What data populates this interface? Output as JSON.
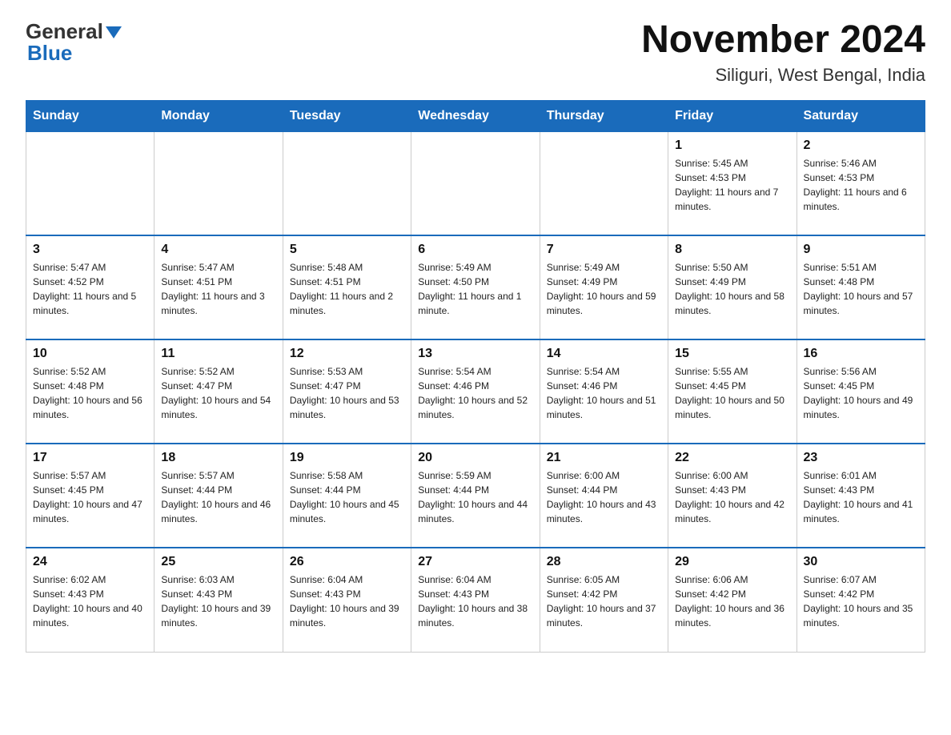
{
  "header": {
    "logo_general": "General",
    "logo_blue": "Blue",
    "month_title": "November 2024",
    "subtitle": "Siliguri, West Bengal, India"
  },
  "days_of_week": [
    "Sunday",
    "Monday",
    "Tuesday",
    "Wednesday",
    "Thursday",
    "Friday",
    "Saturday"
  ],
  "weeks": [
    [
      {
        "num": "",
        "info": ""
      },
      {
        "num": "",
        "info": ""
      },
      {
        "num": "",
        "info": ""
      },
      {
        "num": "",
        "info": ""
      },
      {
        "num": "",
        "info": ""
      },
      {
        "num": "1",
        "info": "Sunrise: 5:45 AM\nSunset: 4:53 PM\nDaylight: 11 hours and 7 minutes."
      },
      {
        "num": "2",
        "info": "Sunrise: 5:46 AM\nSunset: 4:53 PM\nDaylight: 11 hours and 6 minutes."
      }
    ],
    [
      {
        "num": "3",
        "info": "Sunrise: 5:47 AM\nSunset: 4:52 PM\nDaylight: 11 hours and 5 minutes."
      },
      {
        "num": "4",
        "info": "Sunrise: 5:47 AM\nSunset: 4:51 PM\nDaylight: 11 hours and 3 minutes."
      },
      {
        "num": "5",
        "info": "Sunrise: 5:48 AM\nSunset: 4:51 PM\nDaylight: 11 hours and 2 minutes."
      },
      {
        "num": "6",
        "info": "Sunrise: 5:49 AM\nSunset: 4:50 PM\nDaylight: 11 hours and 1 minute."
      },
      {
        "num": "7",
        "info": "Sunrise: 5:49 AM\nSunset: 4:49 PM\nDaylight: 10 hours and 59 minutes."
      },
      {
        "num": "8",
        "info": "Sunrise: 5:50 AM\nSunset: 4:49 PM\nDaylight: 10 hours and 58 minutes."
      },
      {
        "num": "9",
        "info": "Sunrise: 5:51 AM\nSunset: 4:48 PM\nDaylight: 10 hours and 57 minutes."
      }
    ],
    [
      {
        "num": "10",
        "info": "Sunrise: 5:52 AM\nSunset: 4:48 PM\nDaylight: 10 hours and 56 minutes."
      },
      {
        "num": "11",
        "info": "Sunrise: 5:52 AM\nSunset: 4:47 PM\nDaylight: 10 hours and 54 minutes."
      },
      {
        "num": "12",
        "info": "Sunrise: 5:53 AM\nSunset: 4:47 PM\nDaylight: 10 hours and 53 minutes."
      },
      {
        "num": "13",
        "info": "Sunrise: 5:54 AM\nSunset: 4:46 PM\nDaylight: 10 hours and 52 minutes."
      },
      {
        "num": "14",
        "info": "Sunrise: 5:54 AM\nSunset: 4:46 PM\nDaylight: 10 hours and 51 minutes."
      },
      {
        "num": "15",
        "info": "Sunrise: 5:55 AM\nSunset: 4:45 PM\nDaylight: 10 hours and 50 minutes."
      },
      {
        "num": "16",
        "info": "Sunrise: 5:56 AM\nSunset: 4:45 PM\nDaylight: 10 hours and 49 minutes."
      }
    ],
    [
      {
        "num": "17",
        "info": "Sunrise: 5:57 AM\nSunset: 4:45 PM\nDaylight: 10 hours and 47 minutes."
      },
      {
        "num": "18",
        "info": "Sunrise: 5:57 AM\nSunset: 4:44 PM\nDaylight: 10 hours and 46 minutes."
      },
      {
        "num": "19",
        "info": "Sunrise: 5:58 AM\nSunset: 4:44 PM\nDaylight: 10 hours and 45 minutes."
      },
      {
        "num": "20",
        "info": "Sunrise: 5:59 AM\nSunset: 4:44 PM\nDaylight: 10 hours and 44 minutes."
      },
      {
        "num": "21",
        "info": "Sunrise: 6:00 AM\nSunset: 4:44 PM\nDaylight: 10 hours and 43 minutes."
      },
      {
        "num": "22",
        "info": "Sunrise: 6:00 AM\nSunset: 4:43 PM\nDaylight: 10 hours and 42 minutes."
      },
      {
        "num": "23",
        "info": "Sunrise: 6:01 AM\nSunset: 4:43 PM\nDaylight: 10 hours and 41 minutes."
      }
    ],
    [
      {
        "num": "24",
        "info": "Sunrise: 6:02 AM\nSunset: 4:43 PM\nDaylight: 10 hours and 40 minutes."
      },
      {
        "num": "25",
        "info": "Sunrise: 6:03 AM\nSunset: 4:43 PM\nDaylight: 10 hours and 39 minutes."
      },
      {
        "num": "26",
        "info": "Sunrise: 6:04 AM\nSunset: 4:43 PM\nDaylight: 10 hours and 39 minutes."
      },
      {
        "num": "27",
        "info": "Sunrise: 6:04 AM\nSunset: 4:43 PM\nDaylight: 10 hours and 38 minutes."
      },
      {
        "num": "28",
        "info": "Sunrise: 6:05 AM\nSunset: 4:42 PM\nDaylight: 10 hours and 37 minutes."
      },
      {
        "num": "29",
        "info": "Sunrise: 6:06 AM\nSunset: 4:42 PM\nDaylight: 10 hours and 36 minutes."
      },
      {
        "num": "30",
        "info": "Sunrise: 6:07 AM\nSunset: 4:42 PM\nDaylight: 10 hours and 35 minutes."
      }
    ]
  ]
}
